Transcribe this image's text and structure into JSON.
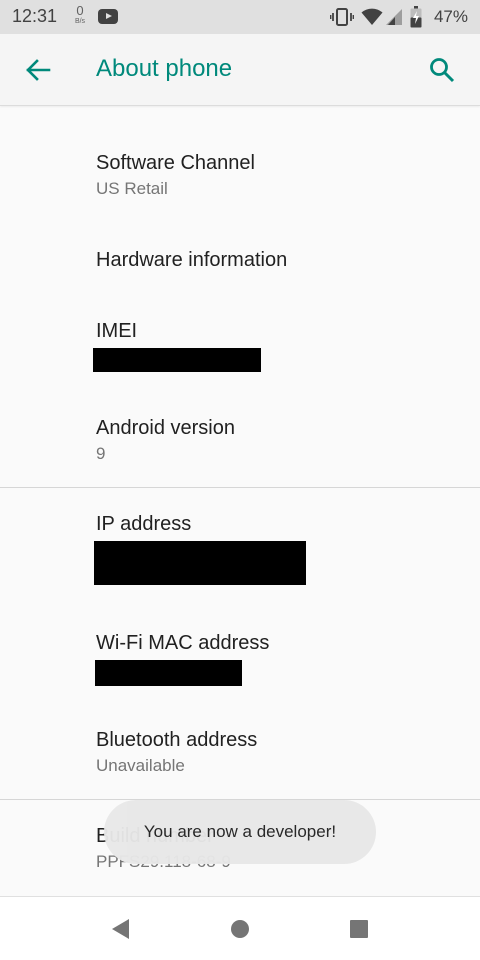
{
  "status_bar": {
    "time": "12:31",
    "net_speed_value": "0",
    "net_speed_unit": "B/s",
    "battery_percent": "47%",
    "icons": [
      "youtube-notification-icon",
      "vibrate-icon",
      "wifi-icon",
      "cell-signal-icon",
      "battery-charging-icon"
    ]
  },
  "app_bar": {
    "title": "About phone",
    "back_icon": "arrow-back-icon",
    "search_icon": "search-icon",
    "accent_color": "#00897b"
  },
  "items": [
    {
      "title": "Software Channel",
      "summary": "US Retail"
    },
    {
      "title": "Hardware information",
      "summary": ""
    },
    {
      "title": "IMEI",
      "summary": "[redacted]"
    },
    {
      "title": "Android version",
      "summary": "9"
    },
    {
      "title": "IP address",
      "summary": "[redacted]"
    },
    {
      "title": "Wi-Fi MAC address",
      "summary": "[redacted]"
    },
    {
      "title": "Bluetooth address",
      "summary": "Unavailable"
    },
    {
      "title": "Build number",
      "summary": "PPFS29.118-68-9"
    }
  ],
  "toast": {
    "message": "You are now a developer!"
  },
  "nav_bar": {
    "icons": [
      "back-triangle-icon",
      "home-circle-icon",
      "recents-square-icon"
    ]
  }
}
